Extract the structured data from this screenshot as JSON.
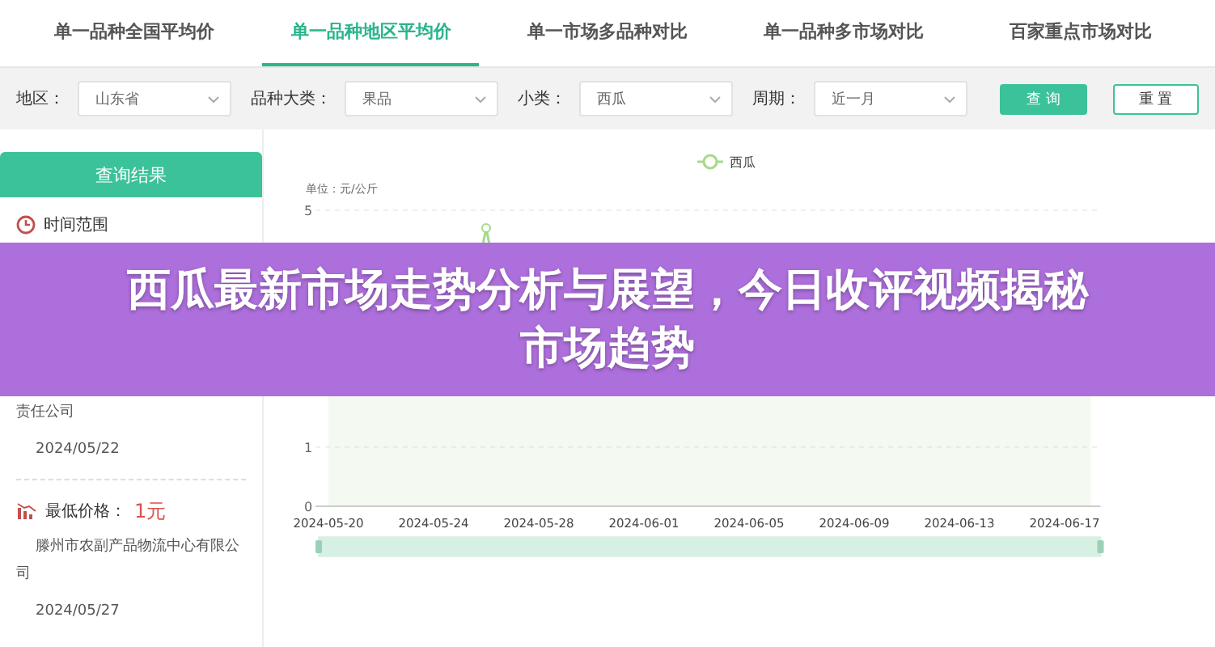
{
  "tabs": [
    {
      "label": "单一品种全国平均价",
      "selected": false
    },
    {
      "label": "单一品种地区平均价",
      "selected": true
    },
    {
      "label": "单一市场多品种对比",
      "selected": false
    },
    {
      "label": "单一品种多市场对比",
      "selected": false
    },
    {
      "label": "百家重点市场对比",
      "selected": false
    }
  ],
  "filters": [
    {
      "label": "地区：",
      "value": "山东省"
    },
    {
      "label": "品种大类：",
      "value": "果品"
    },
    {
      "label": "小类：",
      "value": "西瓜"
    },
    {
      "label": "周期：",
      "value": "近一月"
    }
  ],
  "buttons": [
    {
      "label": "查 询",
      "kind": "primary"
    },
    {
      "label": "重 置",
      "kind": "secondary"
    }
  ],
  "results": {
    "title": "查询结果",
    "time_range_label": "时间范围",
    "prices": [
      {
        "market": "责任公司",
        "date": "2024/05/22"
      },
      {
        "kind": "low",
        "label": "最低价格：",
        "price": "1元",
        "market": "滕州市农副产品物流中心有限公司",
        "date": "2024/05/27"
      }
    ]
  },
  "chart": {
    "legend": "西瓜",
    "range": {
      "level": 1
    },
    "unit": "单位：元/公斤",
    "y_labels": [
      "5",
      "1",
      "0"
    ],
    "x_labels": [
      "2024-05-20",
      "2024-05-24",
      "2024-05-28",
      "2024-06-01",
      "2024-06-05",
      "2024-06-09",
      "2024-06-13",
      "2024-06-17"
    ]
  },
  "banner": {
    "text": "西瓜最新市场走势分析与展望，今日收评视频揭秘市场趋势"
  }
}
